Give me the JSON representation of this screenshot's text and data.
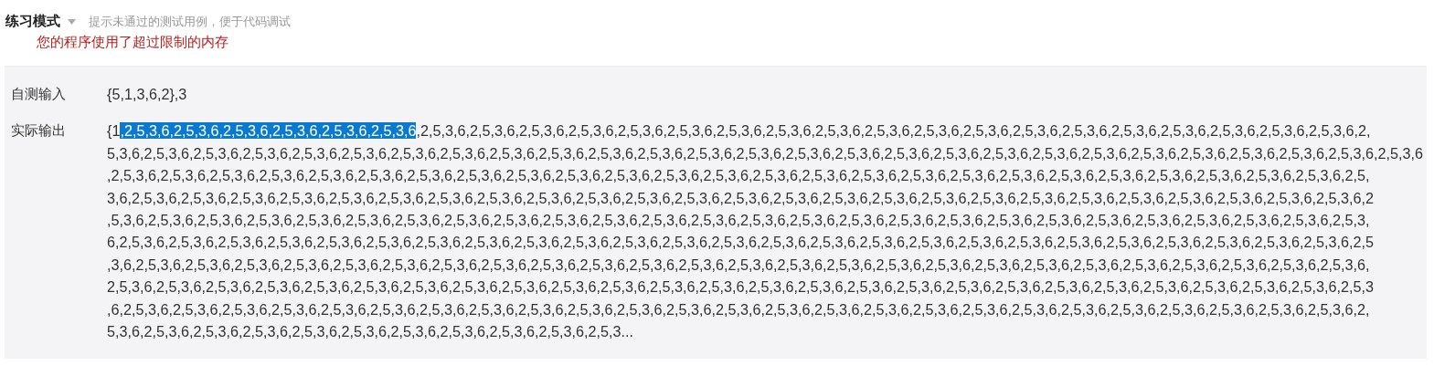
{
  "header": {
    "mode": "练习模式",
    "hint": "提示未通过的测试用例，便于代码调试",
    "error": "您的程序使用了超过限制的内存"
  },
  "rows": [
    {
      "label": "自测输入",
      "lines": [
        {
          "segments": [
            {
              "text": "{5,1,3,6,2},3",
              "highlighted": false
            }
          ]
        }
      ]
    },
    {
      "label": "实际输出",
      "lines": [
        {
          "segments": [
            {
              "text": "{1",
              "highlighted": false
            },
            {
              "text": ",2,5,3,6,2,5,3,6,2,5,3,6,2,5,3,6,2,5,3,6,2,5,3,6",
              "highlighted": true
            },
            {
              "text": ",2,5,3,6,2,5,3,6,2,5,3,6,2,5,3,6,2,5,3,6,2,5,3,6,2,5,3,6,2,5,3,6,2,5,3,6,2,5,3,6,2,5,3,6,2,5,3,6,2,5,3,6,2,5,3,6,2,5,3,6,2,5,3,6,2,5,3,6,2,5,3,6,2,5,3,6,2,",
              "highlighted": false
            }
          ]
        },
        {
          "segments": [
            {
              "text": "5,3,6,2,5,3,6,2,5,3,6,2,5,3,6,2,5,3,6,2,5,3,6,2,5,3,6,2,5,3,6,2,5,3,6,2,5,3,6,2,5,3,6,2,5,3,6,2,5,3,6,2,5,3,6,2,5,3,6,2,5,3,6,2,5,3,6,2,5,3,6,2,5,3,6,2,5,3,6,2,5,3,6,2,5,3,6,2,5,3,6,2,5,3,6,2,5,3,6,2,5,3,6,2,5,3,6",
              "highlighted": false
            }
          ]
        },
        {
          "segments": [
            {
              "text": ",2,5,3,6,2,5,3,6,2,5,3,6,2,5,3,6,2,5,3,6,2,5,3,6,2,5,3,6,2,5,3,6,2,5,3,6,2,5,3,6,2,5,3,6,2,5,3,6,2,5,3,6,2,5,3,6,2,5,3,6,2,5,3,6,2,5,3,6,2,5,3,6,2,5,3,6,2,5,3,6,2,5,3,6,2,5,3,6,2,5,3,6,2,5,3,6,2,5,3,6,2,5,",
              "highlighted": false
            }
          ]
        },
        {
          "segments": [
            {
              "text": "3,6,2,5,3,6,2,5,3,6,2,5,3,6,2,5,3,6,2,5,3,6,2,5,3,6,2,5,3,6,2,5,3,6,2,5,3,6,2,5,3,6,2,5,3,6,2,5,3,6,2,5,3,6,2,5,3,6,2,5,3,6,2,5,3,6,2,5,3,6,2,5,3,6,2,5,3,6,2,5,3,6,2,5,3,6,2,5,3,6,2,5,3,6,2,5,3,6,2,5,3,6,2",
              "highlighted": false
            }
          ]
        },
        {
          "segments": [
            {
              "text": ",5,3,6,2,5,3,6,2,5,3,6,2,5,3,6,2,5,3,6,2,5,3,6,2,5,3,6,2,5,3,6,2,5,3,6,2,5,3,6,2,5,3,6,2,5,3,6,2,5,3,6,2,5,3,6,2,5,3,6,2,5,3,6,2,5,3,6,2,5,3,6,2,5,3,6,2,5,3,6,2,5,3,6,2,5,3,6,2,5,3,6,2,5,3,6,2,5,3,6,2,5,3,",
              "highlighted": false
            }
          ]
        },
        {
          "segments": [
            {
              "text": "6,2,5,3,6,2,5,3,6,2,5,3,6,2,5,3,6,2,5,3,6,2,5,3,6,2,5,3,6,2,5,3,6,2,5,3,6,2,5,3,6,2,5,3,6,2,5,3,6,2,5,3,6,2,5,3,6,2,5,3,6,2,5,3,6,2,5,3,6,2,5,3,6,2,5,3,6,2,5,3,6,2,5,3,6,2,5,3,6,2,5,3,6,2,5,3,6,2,5,3,6,2,5",
              "highlighted": false
            }
          ]
        },
        {
          "segments": [
            {
              "text": ",3,6,2,5,3,6,2,5,3,6,2,5,3,6,2,5,3,6,2,5,3,6,2,5,3,6,2,5,3,6,2,5,3,6,2,5,3,6,2,5,3,6,2,5,3,6,2,5,3,6,2,5,3,6,2,5,3,6,2,5,3,6,2,5,3,6,2,5,3,6,2,5,3,6,2,5,3,6,2,5,3,6,2,5,3,6,2,5,3,6,2,5,3,6,2,5,3,6,2,5,3,6,",
              "highlighted": false
            }
          ]
        },
        {
          "segments": [
            {
              "text": "2,5,3,6,2,5,3,6,2,5,3,6,2,5,3,6,2,5,3,6,2,5,3,6,2,5,3,6,2,5,3,6,2,5,3,6,2,5,3,6,2,5,3,6,2,5,3,6,2,5,3,6,2,5,3,6,2,5,3,6,2,5,3,6,2,5,3,6,2,5,3,6,2,5,3,6,2,5,3,6,2,5,3,6,2,5,3,6,2,5,3,6,2,5,3,6,2,5,3,6,2,5,3",
              "highlighted": false
            }
          ]
        },
        {
          "segments": [
            {
              "text": ",6,2,5,3,6,2,5,3,6,2,5,3,6,2,5,3,6,2,5,3,6,2,5,3,6,2,5,3,6,2,5,3,6,2,5,3,6,2,5,3,6,2,5,3,6,2,5,3,6,2,5,3,6,2,5,3,6,2,5,3,6,2,5,3,6,2,5,3,6,2,5,3,6,2,5,3,6,2,5,3,6,2,5,3,6,2,5,3,6,2,5,3,6,2,5,3,6,2,5,3,6,2,",
              "highlighted": false
            }
          ]
        },
        {
          "segments": [
            {
              "text": "5,3,6,2,5,3,6,2,5,3,6,2,5,3,6,2,5,3,6,2,5,3,6,2,5,3,6,2,5,3,6,2,5,3,6,2,5,3,6,2,5,3...",
              "highlighted": false
            }
          ]
        }
      ]
    }
  ]
}
